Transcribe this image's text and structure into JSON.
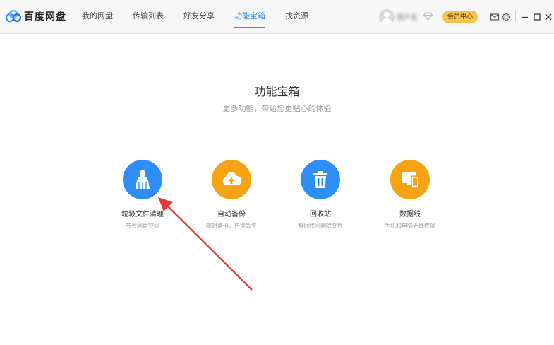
{
  "app": {
    "name": "百度网盘"
  },
  "nav": {
    "items": [
      {
        "label": "我的网盘"
      },
      {
        "label": "传输列表"
      },
      {
        "label": "好友分享"
      },
      {
        "label": "功能宝箱",
        "active": true
      },
      {
        "label": "找资源"
      }
    ]
  },
  "user": {
    "name": "用户名",
    "vip_label": "会员中心"
  },
  "window_icons": [
    "mail-icon",
    "settings-icon",
    "minimize-icon",
    "maximize-icon",
    "close-icon"
  ],
  "main": {
    "title": "功能宝箱",
    "subtitle": "更多功能，带给您更贴心的体验",
    "tools": [
      {
        "name": "垃圾文件清理",
        "desc": "节省网盘空间",
        "icon": "broom-icon",
        "color": "#2f8ef6"
      },
      {
        "name": "自动备份",
        "desc": "随时备份，告别丢失",
        "icon": "cloud-upload-icon",
        "color": "#f5a313"
      },
      {
        "name": "回收站",
        "desc": "帮你找回删除文件",
        "icon": "trash-icon",
        "color": "#2f8ef6"
      },
      {
        "name": "数据线",
        "desc": "手机和电脑无线传输",
        "icon": "devices-icon",
        "color": "#f5a313"
      }
    ]
  },
  "colors": {
    "accent_blue": "#2f8ef6",
    "accent_orange": "#f5a313",
    "vip_gold": "#f5c451",
    "annotation_red": "#e53935"
  }
}
